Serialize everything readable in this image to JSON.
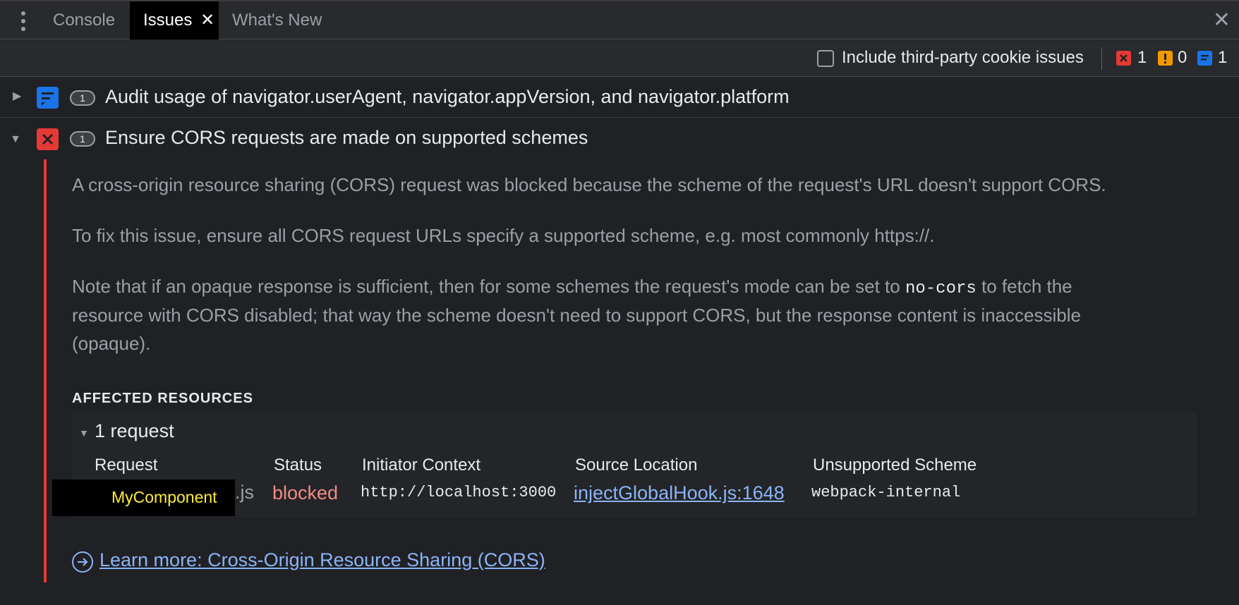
{
  "tabs": {
    "console": "Console",
    "issues": "Issues",
    "whats_new": "What's New"
  },
  "toolbar": {
    "checkbox_label": "Include third-party cookie issues",
    "error_count": "1",
    "warning_count": "0",
    "info_count": "1"
  },
  "issues": [
    {
      "count": "1",
      "title": "Audit usage of navigator.userAgent, navigator.appVersion, and navigator.platform",
      "icon": "info-icon",
      "expanded": false
    },
    {
      "count": "1",
      "title": "Ensure CORS requests are made on supported schemes",
      "icon": "error-icon",
      "expanded": true
    }
  ],
  "details": {
    "p1": "A cross-origin resource sharing (CORS) request was blocked because the scheme of the request's URL doesn't support CORS.",
    "p2": "To fix this issue, ensure all CORS request URLs specify a supported scheme, e.g. most commonly https://.",
    "p3_before": "Note that if an opaque response is sufficient, then for some schemes the request's mode can be set to ",
    "p3_code": "no-cors",
    "p3_after": " to fetch the",
    "p3_line2": "resource with CORS disabled; that way the scheme doesn't need to support CORS, but the response content is inaccessible",
    "p3_line3": "(opaque).",
    "affected_heading": "AFFECTED RESOURCES",
    "request_count": "1 request",
    "columns": [
      "Request",
      "Status",
      "Initiator Context",
      "Source Location",
      "Unsupported Scheme"
    ],
    "row": {
      "request_label": "MyComponent",
      "request_suffix": ".js",
      "status": "blocked",
      "initiator": "http://localhost:3000",
      "source": "injectGlobalHook.js:1648",
      "scheme": "webpack-internal"
    },
    "learn_more": "Learn more: Cross-Origin Resource Sharing (CORS)"
  },
  "colors": {
    "error": "#e53935",
    "warning": "#f29900",
    "info": "#1a73e8",
    "link": "#8ab4f8",
    "blocked": "#f28b82"
  }
}
